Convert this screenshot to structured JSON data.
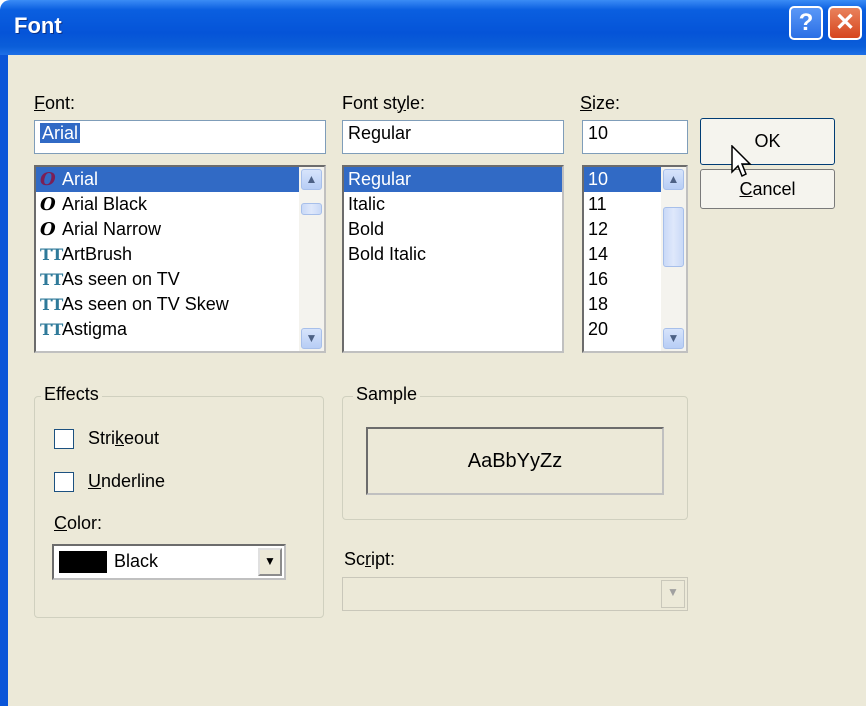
{
  "window": {
    "title": "Font"
  },
  "labels": {
    "font_prefix": "",
    "font_u": "F",
    "font_rest": "ont:",
    "style_prefix": "Font st",
    "style_u": "y",
    "style_rest": "le:",
    "size_prefix": "",
    "size_u": "S",
    "size_rest": "ize:"
  },
  "font": {
    "value": "Arial",
    "items": [
      {
        "icon": "O",
        "label": "Arial",
        "selected": true
      },
      {
        "icon": "O",
        "label": "Arial Black"
      },
      {
        "icon": "O",
        "label": "Arial Narrow"
      },
      {
        "icon": "TT",
        "label": "ArtBrush"
      },
      {
        "icon": "TT",
        "label": "As seen on TV"
      },
      {
        "icon": "TT",
        "label": "As seen on TV Skew"
      },
      {
        "icon": "TT",
        "label": "Astigma"
      }
    ]
  },
  "style": {
    "value": "Regular",
    "items": [
      {
        "label": "Regular",
        "selected": true
      },
      {
        "label": "Italic"
      },
      {
        "label": "Bold"
      },
      {
        "label": "Bold Italic"
      }
    ]
  },
  "size": {
    "value": "10",
    "items": [
      {
        "label": "10",
        "selected": true
      },
      {
        "label": "11"
      },
      {
        "label": "12"
      },
      {
        "label": "14"
      },
      {
        "label": "16"
      },
      {
        "label": "18"
      },
      {
        "label": "20"
      }
    ]
  },
  "buttons": {
    "ok": "OK",
    "cancel_prefix": "",
    "cancel_u": "C",
    "cancel_rest": "ancel"
  },
  "effects": {
    "title": "Effects",
    "strikeout_prefix": "Stri",
    "strikeout_u": "k",
    "strikeout_rest": "eout",
    "underline_prefix": "",
    "underline_u": "U",
    "underline_rest": "nderline",
    "color_prefix": "",
    "color_u": "C",
    "color_rest": "olor:",
    "color_value": "Black",
    "color_swatch": "#000000"
  },
  "sample": {
    "title": "Sample",
    "text": "AaBbYyZz"
  },
  "script": {
    "prefix": "Sc",
    "u": "r",
    "rest": "ipt:",
    "value": ""
  },
  "colors": {
    "selection": "#316ac5",
    "titlebar": "#0554d8",
    "dialog_bg": "#ece9d8"
  },
  "icons": {
    "help": "?",
    "close": "✕",
    "scroll_up": "▲",
    "scroll_down": "▼",
    "dropdown": "▼"
  }
}
